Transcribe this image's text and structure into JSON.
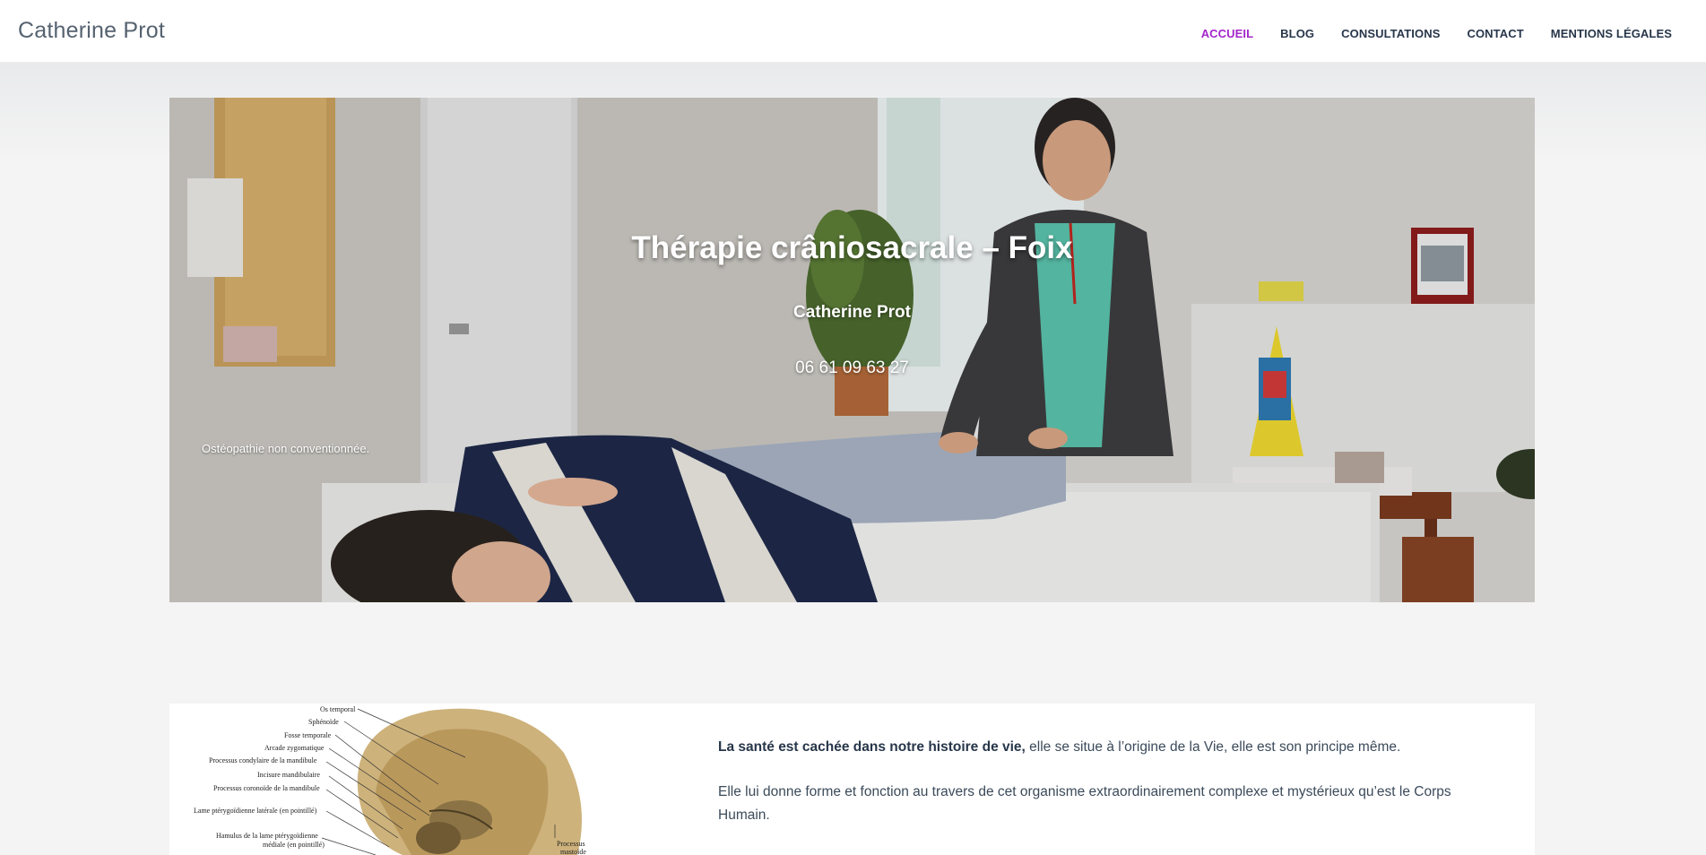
{
  "header": {
    "site_title": "Catherine Prot",
    "nav": [
      {
        "label": "ACCUEIL",
        "active": true
      },
      {
        "label": "BLOG",
        "active": false
      },
      {
        "label": "CONSULTATIONS",
        "active": false
      },
      {
        "label": "CONTACT",
        "active": false
      },
      {
        "label": "MENTIONS LÉGALES",
        "active": false
      }
    ],
    "accent_color": "#a325c9"
  },
  "hero": {
    "title": "Thérapie crâniosacrale – Foix",
    "name": "Catherine Prot",
    "phone": "06 61 09 63 27",
    "caption": "Ostéopathie non conventionnée."
  },
  "intro": {
    "p1_bold": "La santé est cachée dans notre histoire de vie,",
    "p1_rest": " elle se situe à l’origine de la Vie, elle est son principe même.",
    "p2": "Elle lui donne forme et fonction au travers de cet organisme extraordinairement complexe et mystérieux qu’est le Corps Humain."
  },
  "skull_labels": [
    "Os temporal",
    "Sphénoïde",
    "Fosse temporale",
    "Arcade zygomatique",
    "Processus condylaire de la mandibule",
    "Incisure mandibulaire",
    "Processus coronoïde de la mandibule",
    "Lame ptérygoïdienne latérale (en pointillé)",
    "Hamulus de la lame ptérygoïdienne",
    "médiale (en pointillé)",
    "Processus",
    "mastoïde"
  ]
}
